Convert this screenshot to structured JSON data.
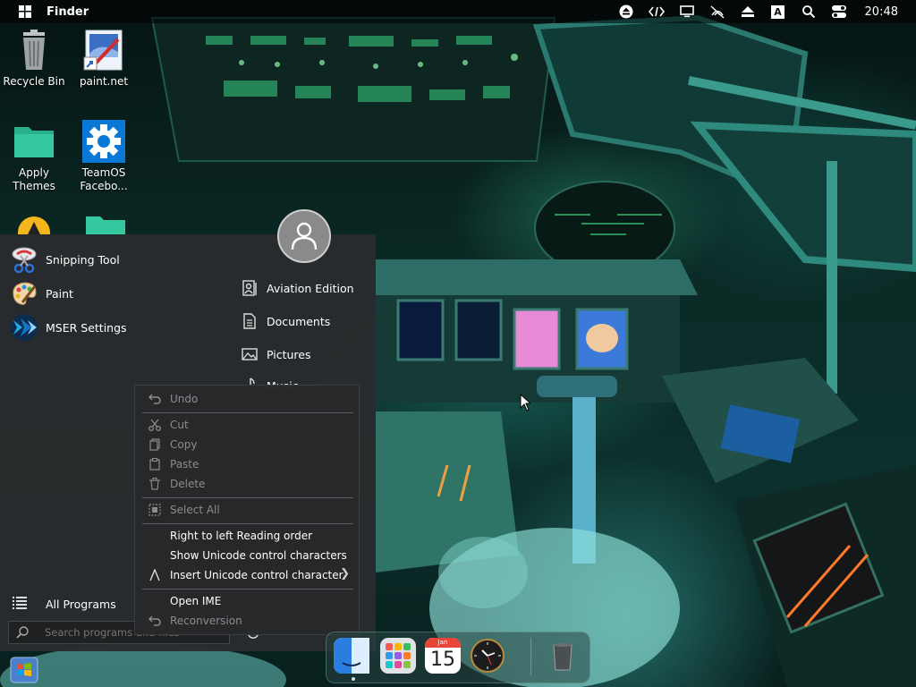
{
  "topbar": {
    "app_name": "Finder",
    "clock": "20:48",
    "input_indicator": "A",
    "tray_icons": [
      "eject-circle-icon",
      "code-icon",
      "monitor-icon",
      "mute-icon",
      "eject-icon",
      "input-method-icon",
      "search-icon",
      "control-center-icon"
    ]
  },
  "desktop": {
    "icons": [
      {
        "label": "Recycle Bin",
        "icon": "recycle-bin-icon"
      },
      {
        "label": "paint.net",
        "icon": "paintnet-icon"
      },
      {
        "label": "Apply Themes",
        "icon": "folder-icon"
      },
      {
        "label": "TeamOS Facebo...",
        "icon": "gear-icon"
      }
    ]
  },
  "start_menu": {
    "pinned": [
      {
        "label": "Snipping Tool",
        "icon": "snipping-tool-icon"
      },
      {
        "label": "Paint",
        "icon": "paint-icon"
      },
      {
        "label": "MSER Settings",
        "icon": "mser-settings-icon"
      }
    ],
    "places": [
      {
        "label": "Aviation Edition",
        "icon": "user-folder-icon"
      },
      {
        "label": "Documents",
        "icon": "document-icon"
      },
      {
        "label": "Pictures",
        "icon": "picture-icon"
      },
      {
        "label": "Music",
        "icon": "music-icon"
      }
    ],
    "all_programs": "All Programs",
    "search_placeholder": "Search programs and files"
  },
  "context_menu": {
    "items": [
      {
        "label": "Undo",
        "icon": "undo-icon",
        "disabled": true
      },
      {
        "label": "Cut",
        "icon": "scissors-icon",
        "disabled": true
      },
      {
        "label": "Copy",
        "icon": "copy-icon",
        "disabled": true
      },
      {
        "label": "Paste",
        "icon": "paste-icon",
        "disabled": true
      },
      {
        "label": "Delete",
        "icon": "trash-icon",
        "disabled": true
      },
      {
        "label": "Select All",
        "icon": "select-all-icon",
        "disabled": true
      },
      {
        "label": "Right to left Reading order",
        "disabled": false
      },
      {
        "label": "Show Unicode control characters",
        "disabled": false
      },
      {
        "label": "Insert Unicode control character",
        "icon": "caret-icon",
        "disabled": false,
        "submenu": true
      },
      {
        "label": "Open IME",
        "disabled": false
      },
      {
        "label": "Reconversion",
        "icon": "reconversion-icon",
        "disabled": true
      }
    ]
  },
  "dock": {
    "calendar_month": "Jan",
    "calendar_day": "15",
    "items": [
      "finder-icon",
      "launchpad-icon",
      "calendar-icon",
      "clock-icon",
      "trash-icon"
    ]
  }
}
